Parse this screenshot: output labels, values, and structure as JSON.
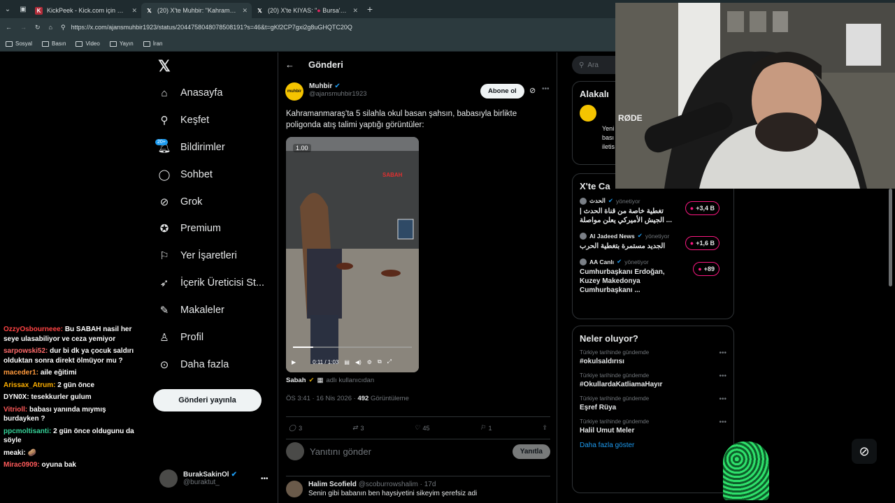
{
  "browser": {
    "tabs": [
      {
        "title": "KickPeek - Kick.com için Gerçek Za",
        "fav": "K",
        "fav_color": "#b22d3a"
      },
      {
        "title": "(20) X'te ",
        "title2": "Muhbir: \"Kahramanm",
        "fav": "X",
        "fav_color": "#000000"
      },
      {
        "title": "(20) X'te KIYAS: \"",
        "title2": "Bursa'da sosy",
        "fav": "X",
        "fav_color": "#000000"
      }
    ],
    "url": "https://x.com/ajansmuhbir1923/status/2044758048078508191?s=46&t=gKf2CP7gxi2g8uGHQTC20Q",
    "bookmarks": [
      "Sosyal",
      "Basın",
      "Video",
      "Yayın",
      "İran"
    ]
  },
  "chat": [
    {
      "user": "OzzyOsbourneee:",
      "text": "Bu SABAH nasil her seye ulasabiliyor ve ceza yemiyor",
      "color": "#ff4444"
    },
    {
      "user": "sarpowski52:",
      "text": "dur bi dk ya çocuk saldırı olduktan sonra direkt ölmüyor mu ?",
      "color": "#ff6b6b"
    },
    {
      "user": "maceder1:",
      "text": "aile eğitimi",
      "color": "#ff9a3c"
    },
    {
      "user": "Arissax_Atrum:",
      "text": "2 gün önce",
      "color": "#ffb000"
    },
    {
      "user": "DYN0X:",
      "text": "tesekkurler gulum",
      "color": "#ffffff"
    },
    {
      "user": "Vitrioll:",
      "text": "babası yanında mıymış burdayken ?",
      "color": "#ff5a5a"
    },
    {
      "user": "ppcmoltisanti:",
      "text": "2 gün önce oldugunu da söyle",
      "color": "#36d399"
    },
    {
      "user": "meaki:",
      "text": "🥔",
      "color": "#ffffff"
    },
    {
      "user": "Mirac0909:",
      "text": "oyuna bak",
      "color": "#ff5a5a"
    }
  ],
  "nav": {
    "logo": "X",
    "items": [
      "Anasayfa",
      "Keşfet",
      "Bildirimler",
      "Sohbet",
      "Grok",
      "Premium",
      "Yer İşaretleri",
      "İçerik Üreticisi St...",
      "Makaleler",
      "Profil",
      "Daha fazla"
    ],
    "badge": "20+",
    "post_button": "Gönderi yayınla",
    "me": {
      "name": "BurakSakinOl",
      "handle": "@buraktut_"
    }
  },
  "post": {
    "header": "Gönderi",
    "author_name": "Muhbir",
    "author_handle": "@ajansmuhbir1923",
    "follow_button": "Abone ol",
    "text": "Kahramanmaraş'ta 5 silahla okul basan şahsın, babasıyla birlikte poligonda atış talimi yaptığı görüntüler:",
    "video": {
      "speed": "1.00",
      "time": "0:11 / 1:03",
      "watermark": "SABAH",
      "progress": 0.17
    },
    "source": "Sabah",
    "source_suffix": "adlı kullanıcıdan",
    "meta_time": "ÖS 3:41 · 16 Nis 2026 · ",
    "views": "492",
    "views_label": "Görüntüleme",
    "replies": "3",
    "reposts": "3",
    "likes": "45",
    "bookmarks": "1",
    "reply_placeholder": "Yanıtını gönder",
    "reply_button": "Yanıtla",
    "comment": {
      "name": "Halim Scofield",
      "handle": "@scoburrowshalim · 17d",
      "text": "Senin gibi babanın ben haysiyetini sikeyim şerefsiz adi"
    }
  },
  "right": {
    "search_placeholder": "Ara",
    "related_title": "Alakalı k",
    "related_preview": [
      "Yeni",
      "bası",
      "iletis"
    ],
    "live_title": "X'te Ca",
    "live": [
      {
        "host": "الحدث",
        "status": "yönetiyor",
        "title": "تغطية خاصة من قناة الحدث | الجيش الأميركي يعلن مواصلة ...",
        "count": "+3,4 B"
      },
      {
        "host": "Al Jadeed News",
        "status": "yönetiyor",
        "title": "الجديد مستمرة بتغطية الحرب",
        "count": "+1,6 B"
      },
      {
        "host": "AA Canlı",
        "status": "yönetiyor",
        "title": "Cumhurbaşkanı Erdoğan, Kuzey Makedonya Cumhurbaşkanı ...",
        "count": "+89"
      }
    ],
    "trends_title": "Neler oluyor?",
    "trends": [
      {
        "context": "Türkiye tarihinde gündemde",
        "name": "#okulsaldırısı"
      },
      {
        "context": "Türkiye tarihinde gündemde",
        "name": "#OkullardaKatliamaHayır"
      },
      {
        "context": "Türkiye tarihinde gündemde",
        "name": "Eşref Rüya"
      },
      {
        "context": "Türkiye tarihinde gündemde",
        "name": "Halil Umut Meler"
      }
    ],
    "show_more": "Daha fazla göster"
  },
  "webcam": {
    "mic_label": "RØDE"
  }
}
